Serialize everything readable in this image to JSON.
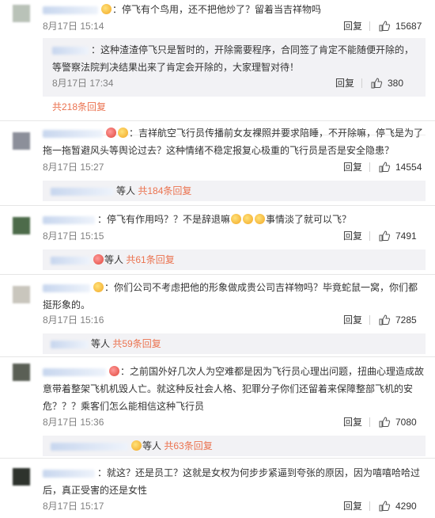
{
  "labels": {
    "reply": "回复"
  },
  "comments": [
    {
      "text": "：停飞有个鸟用，还不把他炒了？留着当吉祥物吗",
      "date": "8月17日 15:14",
      "likes": "15687",
      "sub": {
        "text": "：这种渣渣停飞只是暂时的，开除需要程序，合同签了肯定不能随便开除的，等警察法院判决结果出来了肯定会开除的，大家理智对待！",
        "date": "8月17日 17:34",
        "likes": "380"
      },
      "more": "共218条回复"
    },
    {
      "text": "：吉祥航空飞行员传播前女友裸照并要求陪睡，不开除嘛，停飞是为了拖一拖暂避风头等舆论过去？这种情绪不稳定报复心极重的飞行员是否是安全隐患？",
      "date": "8月17日 15:27",
      "likes": "14554",
      "more_prefix": "等人",
      "more": "共184条回复"
    },
    {
      "text_a": "：停飞有作用吗？？不是辞退嘛",
      "text_b": "事情淡了就可以飞？",
      "date": "8月17日 15:15",
      "likes": "7491",
      "more_prefix": "等人",
      "more": "共61条回复"
    },
    {
      "text": "：你们公司不考虑把他的形象做成贵公司吉祥物吗？毕竟蛇鼠一窝，你们都挺形象的。",
      "date": "8月17日 15:16",
      "likes": "7285",
      "more_prefix": "等人",
      "more": "共59条回复"
    },
    {
      "text": "：之前国外好几次人为空难都是因为飞行员心理出问题，扭曲心理造成故意带着整架飞机机毁人亡。就这种反社会人格、犯罪分子你们还留着来保障整部飞机的安危？？？乘客们怎么能相信这种飞行员",
      "date": "8月17日 15:36",
      "likes": "7080",
      "more_prefix": "等人",
      "more": "共63条回复"
    },
    {
      "text": "：就这？还是员工？这就是女权为何步步紧逼到夸张的原因，因为嘻嘻哈哈过后，真正受害的还是女性",
      "date": "8月17日 15:17",
      "likes": "4290"
    }
  ]
}
